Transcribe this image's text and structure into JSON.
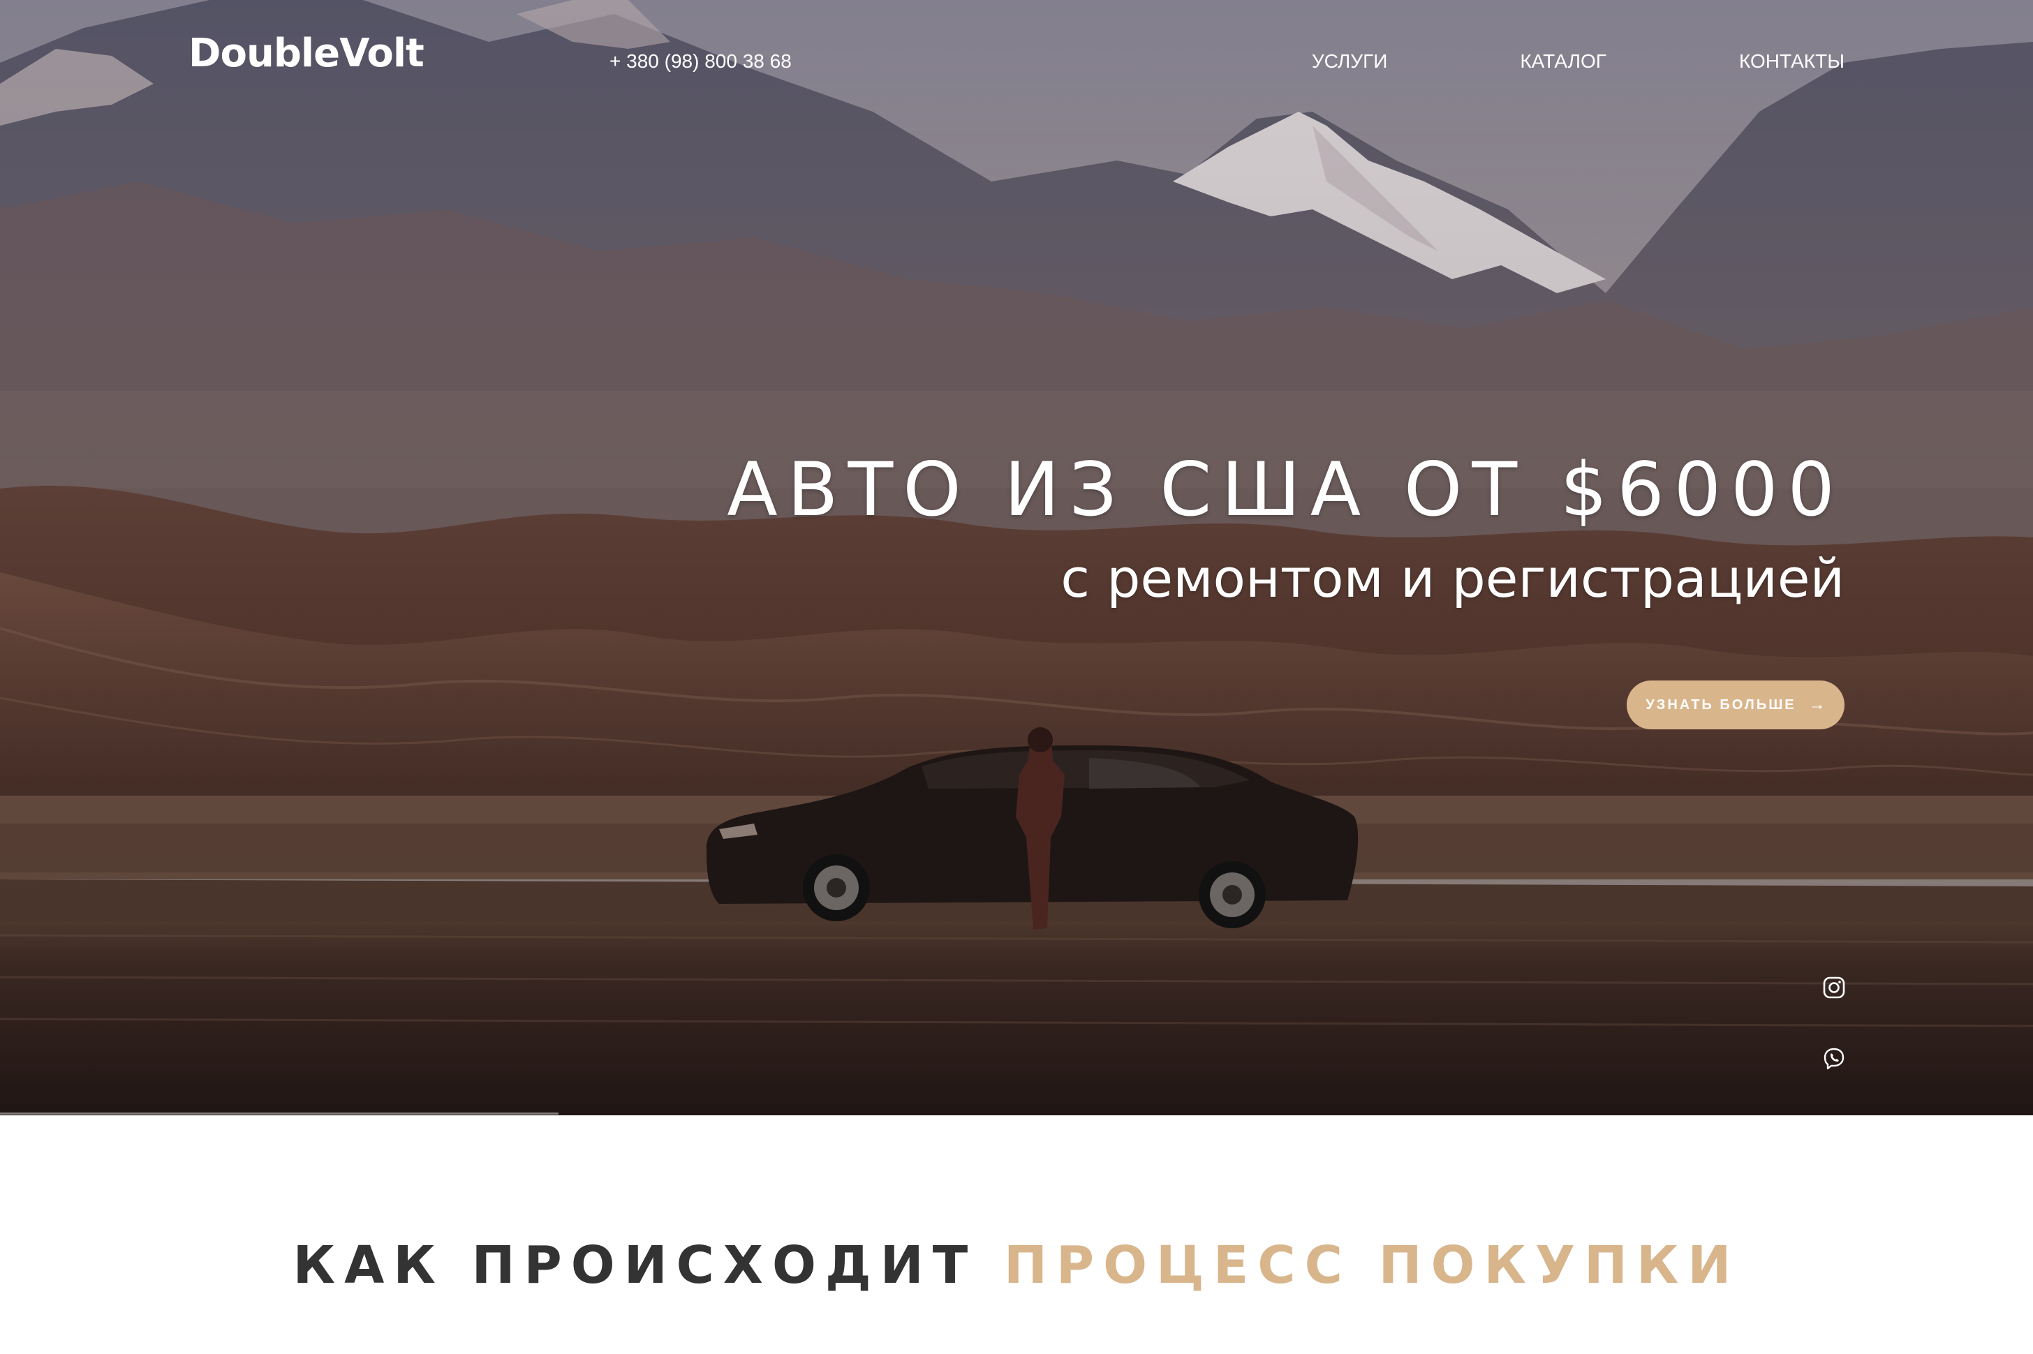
{
  "header": {
    "logo": "DoubleVolt",
    "phone": "+ 380 (98) 800 38 68",
    "nav": [
      {
        "label": "УСЛУГИ"
      },
      {
        "label": "КАТАЛОГ"
      },
      {
        "label": "КОНТАКТЫ"
      }
    ]
  },
  "hero": {
    "title": "АВТО ИЗ США ОТ $6000",
    "subtitle": "с ремонтом и регистрацией",
    "cta_label": "УЗНАТЬ БОЛЬШЕ",
    "cta_arrow": "→",
    "social": [
      {
        "icon": "instagram-icon"
      },
      {
        "icon": "viber-icon"
      }
    ]
  },
  "section": {
    "heading_part1": "КАК ПРОИСХОДИТ",
    "heading_part2": "ПРОЦЕСС ПОКУПКИ"
  },
  "colors": {
    "accent": "#d9b58c",
    "heading_dark": "#333333",
    "text_light": "#ffffff"
  }
}
